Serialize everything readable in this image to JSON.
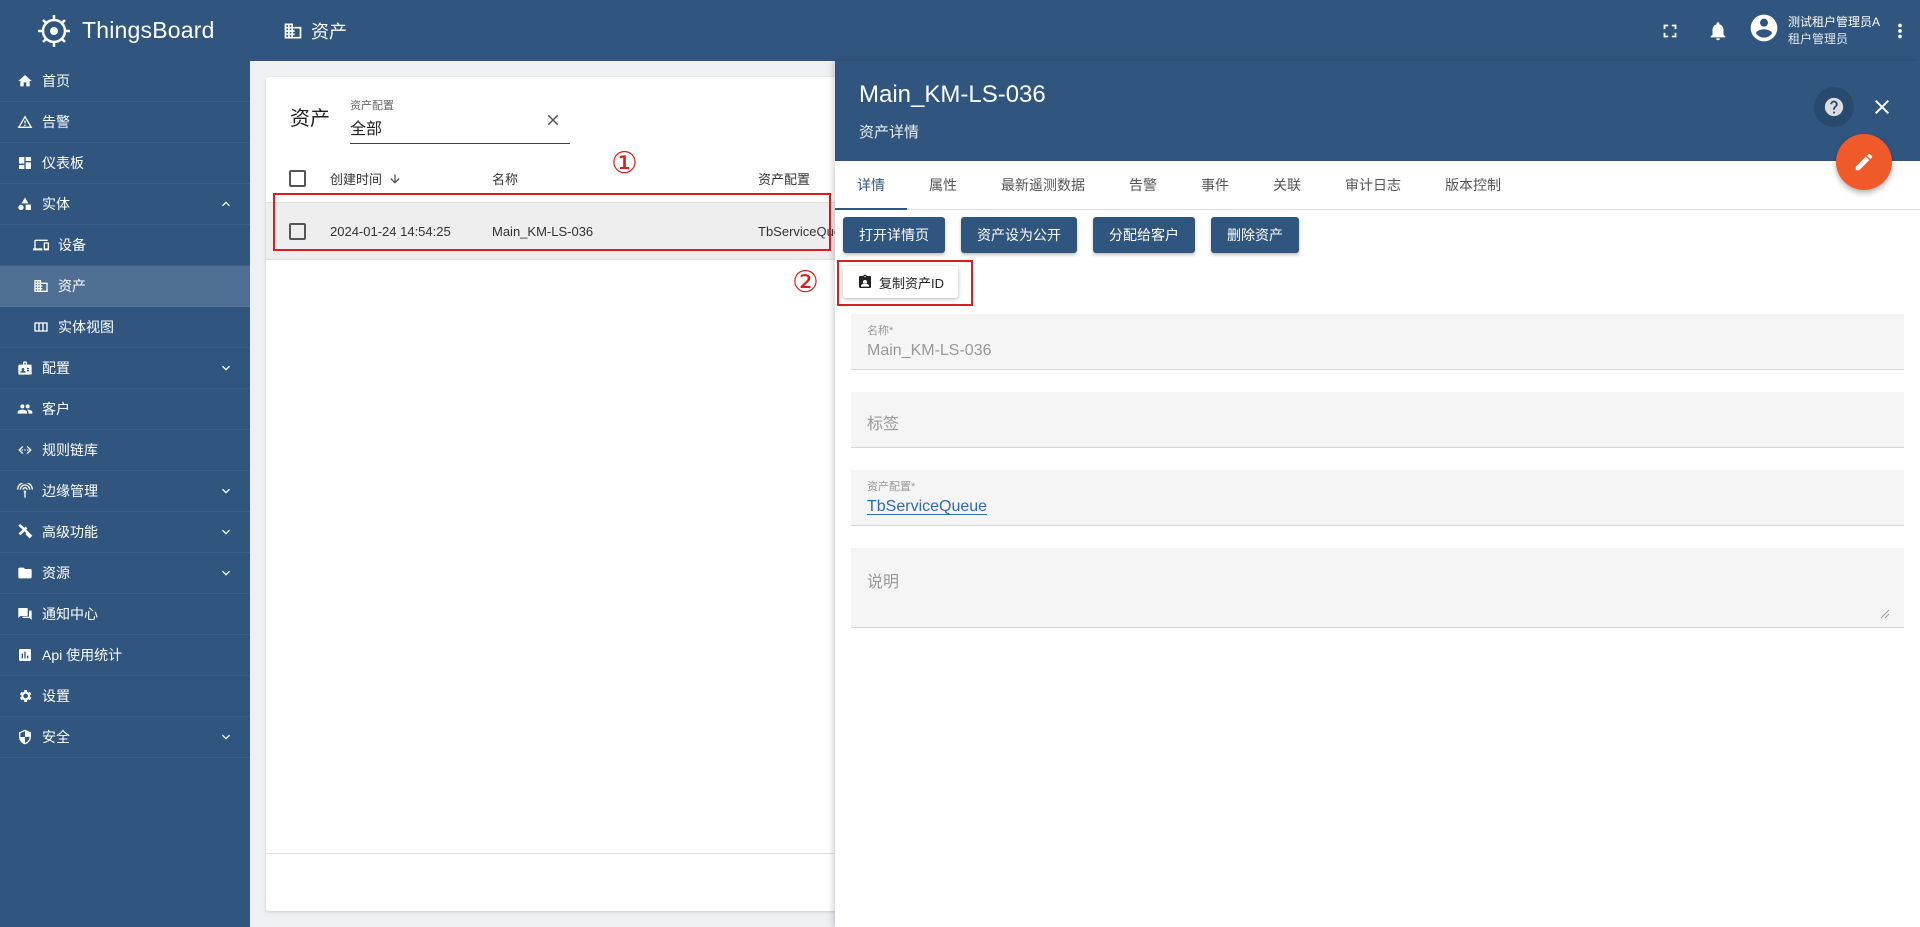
{
  "brand": {
    "name": "ThingsBoard"
  },
  "sidebar": {
    "items": [
      {
        "label": "首页",
        "icon": "home-icon"
      },
      {
        "label": "告警",
        "icon": "warning-icon"
      },
      {
        "label": "仪表板",
        "icon": "dashboard-icon"
      },
      {
        "label": "实体",
        "icon": "entity-icon",
        "expanded": true
      },
      {
        "label": "设备",
        "icon": "device-icon",
        "sub": true
      },
      {
        "label": "资产",
        "icon": "asset-icon",
        "sub": true,
        "active": true
      },
      {
        "label": "实体视图",
        "icon": "entity-view-icon",
        "sub": true
      },
      {
        "label": "配置",
        "icon": "profiles-icon",
        "collapsible": true
      },
      {
        "label": "客户",
        "icon": "customers-icon"
      },
      {
        "label": "规则链库",
        "icon": "rule-chain-icon"
      },
      {
        "label": "边缘管理",
        "icon": "edge-icon",
        "collapsible": true
      },
      {
        "label": "高级功能",
        "icon": "tools-icon",
        "collapsible": true
      },
      {
        "label": "资源",
        "icon": "folder-icon",
        "collapsible": true
      },
      {
        "label": "通知中心",
        "icon": "notification-icon"
      },
      {
        "label": "Api 使用统计",
        "icon": "chart-icon"
      },
      {
        "label": "设置",
        "icon": "gear-icon"
      },
      {
        "label": "安全",
        "icon": "shield-icon",
        "collapsible": true
      }
    ]
  },
  "topbar": {
    "breadcrumb": "资产",
    "user_name": "测试租户管理员A",
    "user_role": "租户管理员"
  },
  "list": {
    "title": "资产",
    "filter_label": "资产配置",
    "filter_value": "全部",
    "columns": {
      "created": "创建时间",
      "name": "名称",
      "profile": "资产配置"
    },
    "rows": [
      {
        "created": "2024-01-24 14:54:25",
        "name": "Main_KM-LS-036",
        "profile": "TbServiceQueue"
      }
    ]
  },
  "annotations": {
    "one": "①",
    "two": "②"
  },
  "details": {
    "title": "Main_KM-LS-036",
    "subtitle": "资产详情",
    "tabs": [
      "详情",
      "属性",
      "最新遥测数据",
      "告警",
      "事件",
      "关联",
      "审计日志",
      "版本控制"
    ],
    "buttons": {
      "open": "打开详情页",
      "make_public": "资产设为公开",
      "assign": "分配给客户",
      "delete": "删除资产",
      "copy_id": "复制资产ID"
    },
    "fields": {
      "name_label": "名称*",
      "name_value": "Main_KM-LS-036",
      "label_placeholder": "标签",
      "profile_label": "资产配置*",
      "profile_value": "TbServiceQueue",
      "description_placeholder": "说明"
    }
  },
  "colors": {
    "primary": "#305680",
    "accent": "#f05a28",
    "highlight": "#d81e1e"
  }
}
